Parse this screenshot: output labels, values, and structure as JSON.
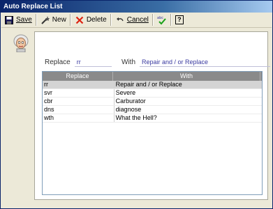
{
  "window": {
    "title": "Auto Replace List"
  },
  "toolbar": {
    "save_label": "Save",
    "new_label": "New",
    "delete_label": "Delete",
    "cancel_label": "Cancel",
    "help_glyph": "?"
  },
  "form": {
    "replace_label": "Replace",
    "replace_value": "rr",
    "with_label": "With",
    "with_value": "Repair and / or Replace"
  },
  "table": {
    "headers": [
      "Replace",
      "With"
    ],
    "rows": [
      [
        "rr",
        "Repair and / or Replace"
      ],
      [
        "svr",
        "Severe"
      ],
      [
        "cbr",
        "Carburator"
      ],
      [
        "dns",
        "diagnose"
      ],
      [
        "wth",
        "What the Hell?"
      ]
    ],
    "selected_row": 0
  },
  "colors": {
    "title_start": "#0a246a",
    "title_end": "#a6caf0",
    "header_bg": "#8a8a8a",
    "selected_bg": "#d4d4d4"
  }
}
